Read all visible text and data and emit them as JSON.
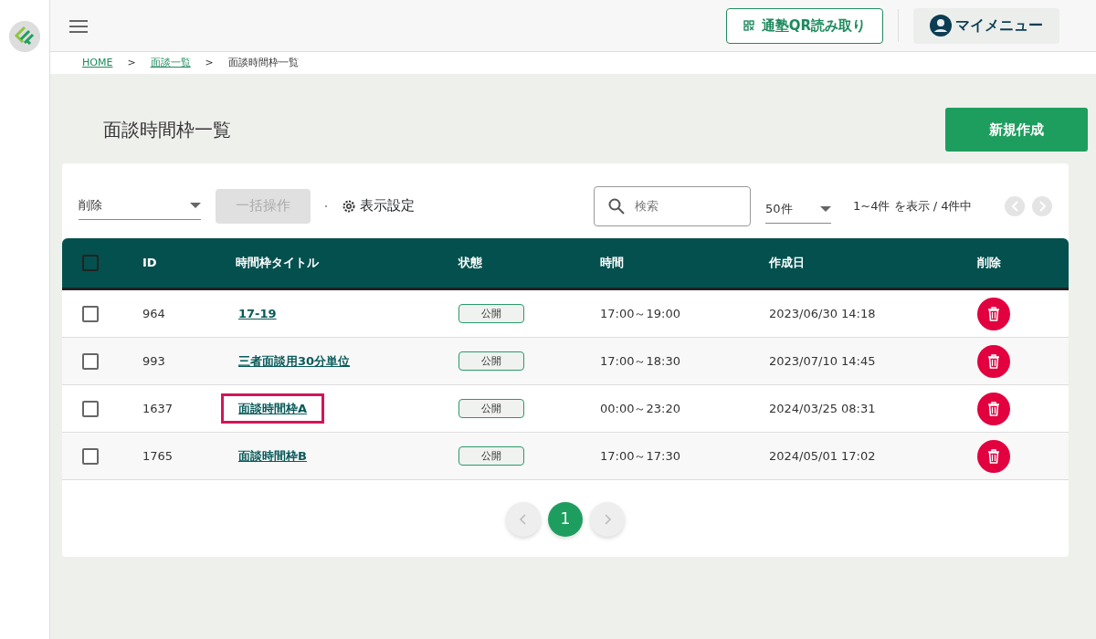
{
  "header": {
    "qr_button": "通塾QR読み取り",
    "my_menu": "マイメニュー"
  },
  "breadcrumb": [
    {
      "label": "HOME",
      "link": true
    },
    {
      "label": "面談一覧",
      "link": true
    },
    {
      "label": "面談時間枠一覧",
      "link": false
    }
  ],
  "breadcrumb_separator": ">",
  "page_title": "面談時間枠一覧",
  "new_button": "新規作成",
  "toolbar": {
    "bulk_select": "削除",
    "bulk_button": "一括操作",
    "bulk_disabled": true,
    "display_settings": "表示設定",
    "search_placeholder": "検索",
    "per_page": "50件",
    "range_text": "1~4件 を表示 / 4件中"
  },
  "table": {
    "columns": [
      "ID",
      "時間枠タイトル",
      "状態",
      "時間",
      "作成日",
      "削除"
    ],
    "all_checked": false,
    "rows": [
      {
        "checked": false,
        "id": "964",
        "title": "17-19",
        "status": "公開",
        "time": "17:00～19:00",
        "created": "2023/06/30 14:18",
        "highlighted": false
      },
      {
        "checked": false,
        "id": "993",
        "title": "三者面談用30分単位",
        "status": "公開",
        "time": "17:00～18:30",
        "created": "2023/07/10 14:45",
        "highlighted": false
      },
      {
        "checked": false,
        "id": "1637",
        "title": "面談時間枠A",
        "status": "公開",
        "time": "00:00～23:20",
        "created": "2024/03/25 08:31",
        "highlighted": true
      },
      {
        "checked": false,
        "id": "1765",
        "title": "面談時間枠B",
        "status": "公開",
        "time": "17:00～17:30",
        "created": "2024/05/01 17:02",
        "highlighted": false
      }
    ]
  },
  "pagination": [
    {
      "label": "1",
      "selected": true
    }
  ]
}
